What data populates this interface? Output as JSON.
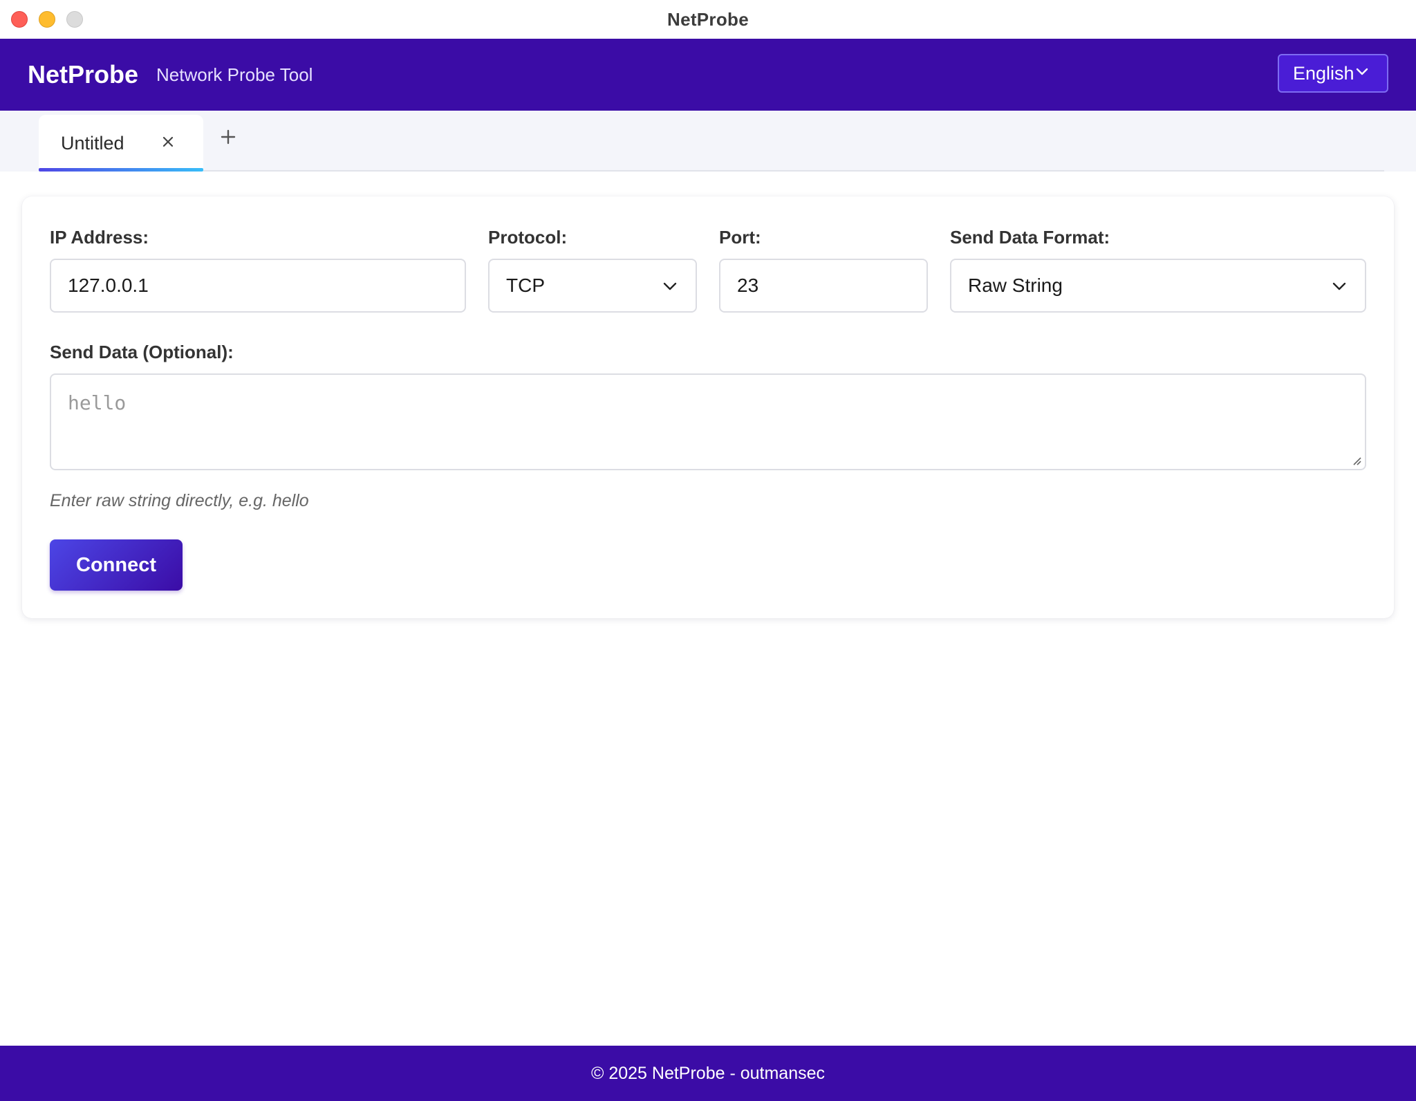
{
  "window": {
    "title": "NetProbe"
  },
  "header": {
    "brand": "NetProbe",
    "tagline": "Network Probe Tool",
    "language": "English"
  },
  "tabs": [
    {
      "label": "Untitled",
      "active": true
    }
  ],
  "form": {
    "ip_label": "IP Address:",
    "ip_value": "127.0.0.1",
    "protocol_label": "Protocol:",
    "protocol_value": "TCP",
    "port_label": "Port:",
    "port_value": "23",
    "format_label": "Send Data Format:",
    "format_value": "Raw String",
    "send_label": "Send Data (Optional):",
    "send_placeholder": "hello",
    "hint": "Enter raw string directly, e.g. hello",
    "connect_label": "Connect"
  },
  "footer": {
    "text": "© 2025 NetProbe - outmansec"
  },
  "colors": {
    "brand": "#3b0ca6",
    "accent": "#4f46e5",
    "tab_underline_end": "#38bdf8"
  },
  "icons": {
    "tab_close": "close-icon",
    "add_tab": "plus-icon",
    "dropdown": "chevron-down-icon"
  }
}
